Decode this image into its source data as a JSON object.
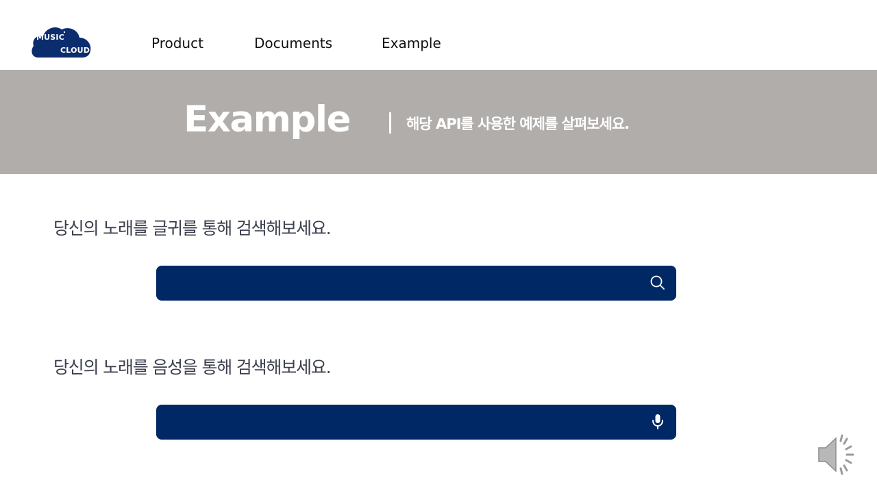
{
  "header": {
    "logo": {
      "line1": "MUSIC",
      "line2": "CLOUD",
      "color": "#0b2d6e"
    },
    "nav": {
      "product": "Product",
      "documents": "Documents",
      "example": "Example"
    }
  },
  "banner": {
    "title": "Example",
    "subtitle": "해당 API를 사용한 예제를 살펴보세요.",
    "background": "#b0adab"
  },
  "sections": {
    "text_search": {
      "title": "당신의 노래를 글귀를 통해 검색해보세요.",
      "value": "",
      "icon": "search-icon"
    },
    "voice_search": {
      "title": "당신의 노래를 음성을 통해 검색해보세요.",
      "value": "",
      "icon": "microphone-icon"
    }
  },
  "colors": {
    "search_box": "#002864",
    "section_text": "#3b3f4c"
  },
  "audio": {
    "icon": "speaker-icon"
  }
}
